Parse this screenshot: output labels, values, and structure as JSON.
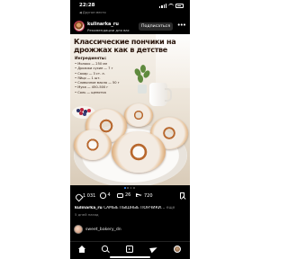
{
  "status_bar": {
    "time": "22:28",
    "back_link": "◀ Другое место"
  },
  "post": {
    "username": "kulinarka_ru",
    "subtitle": "Рекомендации для вас",
    "subscribe_label": "Подписаться",
    "image": {
      "title": "Классические пончики на дрожжах как в детстве",
      "ingredients_title": "Ингредиенты:",
      "ingredients": [
        "• Молоко — 250 мл",
        "• Дрожжи сухие — 7 г",
        "• Сахар — 3 ст. л.",
        "• Яйцо — 1 шт.",
        "• Сливочное масло — 50 г",
        "• Мука — 450–500 г",
        "• Соль — щепотка"
      ]
    },
    "likes": "1 031",
    "comments": "4",
    "reposts": "26",
    "shares": "720",
    "caption_user": "kulinarka_ru",
    "caption_text": "САМЫЕ ПЫШНЫЕ ПОНЧИКИ…",
    "caption_more": "ещё",
    "date": "5 дней назад"
  },
  "next_post": {
    "username": "sweet_bakery_dn"
  },
  "icons": {
    "like": "heart-icon",
    "comment": "comment-icon",
    "repost": "repost-icon",
    "share": "send-icon",
    "save": "bookmark-icon",
    "nav": [
      "home-icon",
      "search-icon",
      "reels-icon",
      "send-icon",
      "profile-avatar"
    ]
  },
  "colors": {
    "background": "#000000",
    "subscribe_button": "#2a2a2a",
    "carousel_active": "#3d8ef7"
  }
}
